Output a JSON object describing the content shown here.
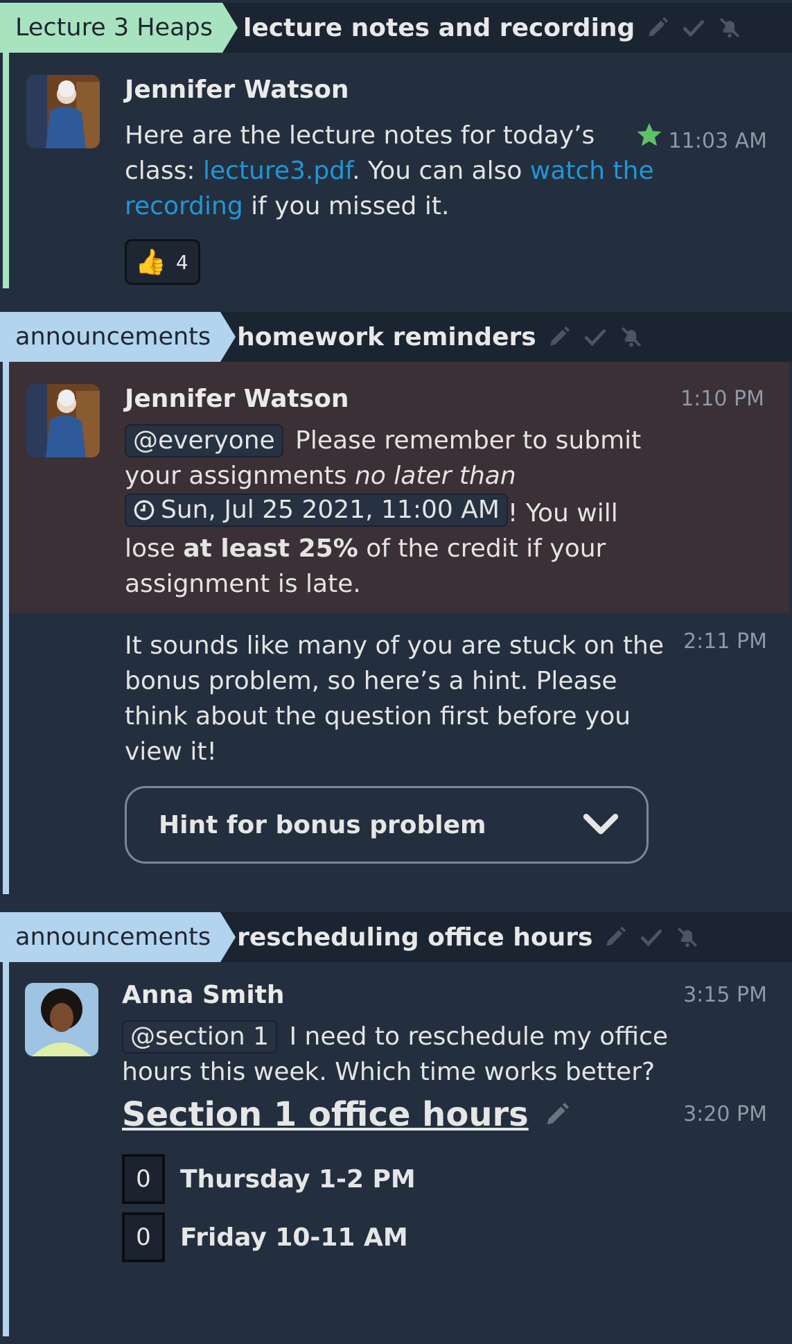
{
  "blocks": [
    {
      "stream": "Lecture 3 Heaps",
      "stream_color": "#a8e3bf",
      "topic": "lecture notes and recording",
      "messages": [
        {
          "sender": "Jennifer Watson",
          "time": "11:03 AM",
          "starred": true,
          "text_1": "Here are the lecture notes for today’s class: ",
          "link_1": "lecture3.pdf",
          "text_2": ". You can also ",
          "link_2": "watch the recording",
          "text_3": " if you missed it.",
          "reaction": {
            "emoji": "👍",
            "count": "4"
          }
        }
      ]
    },
    {
      "stream": "announcements",
      "stream_color": "#b3d4ef",
      "topic": "homework reminders",
      "messages": [
        {
          "sender": "Jennifer Watson",
          "time": "1:10 PM",
          "mention": "@everyone",
          "text_1": " Please remember to submit your assignments ",
          "em_1": "no later than",
          "timestamp": "Sun, Jul 25 2021, 11:00 AM",
          "text_2": "! You will lose ",
          "strong_1": "at least 25%",
          "text_3": " of the credit if your assignment is late."
        },
        {
          "time": "2:11 PM",
          "text": "It sounds like many of you are stuck on the bonus problem, so here’s a hint. Please think about the question first before you view it!",
          "spoiler_title": "Hint for bonus problem"
        }
      ]
    },
    {
      "stream": "announcements",
      "stream_color": "#b3d4ef",
      "topic": "rescheduling office hours",
      "messages": [
        {
          "sender": "Anna Smith",
          "time": "3:15 PM",
          "mention": "@section 1",
          "text": " I need to reschedule my office hours this week. Which time works better?"
        },
        {
          "time": "3:20 PM",
          "poll_title": "Section 1 office hours",
          "options": [
            {
              "votes": "0",
              "label": "Thursday 1-2 PM"
            },
            {
              "votes": "0",
              "label": "Friday 10-11 AM"
            }
          ]
        }
      ]
    }
  ],
  "icons": {
    "edit": "pencil-icon",
    "resolve": "check-icon",
    "mute": "bell-slash-icon",
    "star": "star-icon",
    "chevron": "chevron-down-icon",
    "clock": "clock-icon"
  },
  "colors": {
    "link": "#2196d6",
    "star": "#5ec26a",
    "highlight_bg": "#3a3036"
  }
}
